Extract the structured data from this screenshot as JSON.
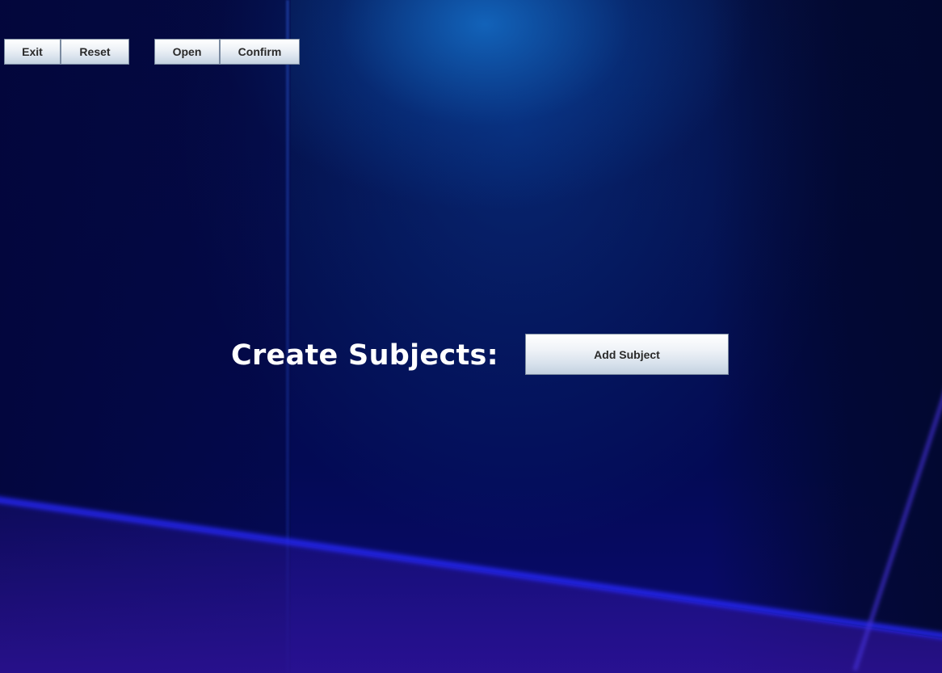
{
  "toolbar": {
    "exit_label": "Exit",
    "reset_label": "Reset",
    "open_label": "Open",
    "confirm_label": "Confirm"
  },
  "main": {
    "heading": "Create Subjects:",
    "add_subject_label": "Add Subject"
  },
  "colors": {
    "background": "#03053f",
    "button_top": "#ffffff",
    "button_bottom": "#c3d1df",
    "heading_text": "#ffffff"
  }
}
